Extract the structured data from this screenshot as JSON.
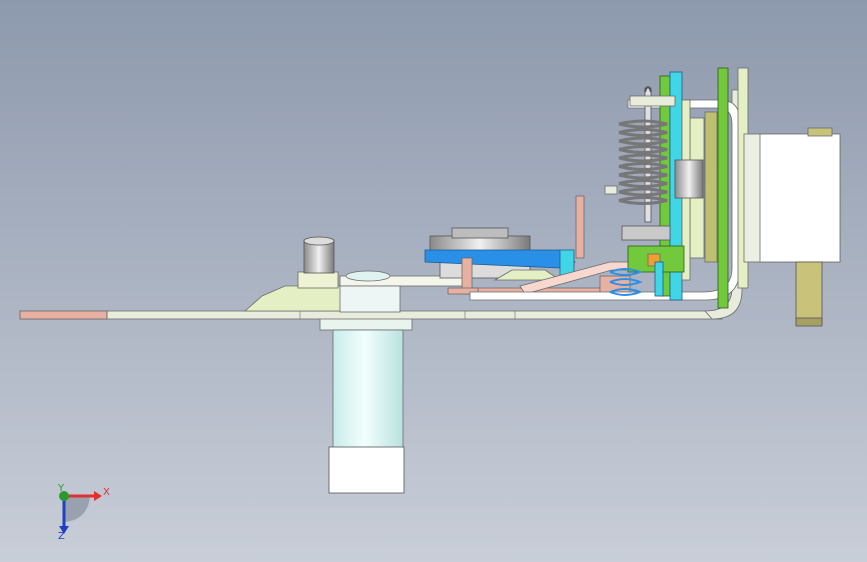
{
  "viewport": {
    "background_top": "#8d99ad",
    "background_bottom": "#c9ced8"
  },
  "colors": {
    "plate": "#e8ecdc",
    "plate_edge": "#6b6b6b",
    "salmon": "#e7b0a2",
    "cyan": "#40d6e6",
    "blue": "#2a8fe6",
    "green": "#73c93c",
    "olive": "#bcc070",
    "khaki": "#c9c27a",
    "light_green": "#e4efc4",
    "pale_cyan": "#d9f6f4",
    "metal": "#c9c9c9",
    "white": "#ffffff",
    "spring": "#d0d0d0",
    "orange": "#f0a030"
  },
  "triad": {
    "x_label": "X",
    "y_label": "Y",
    "z_label": "Z",
    "x_color": "#e03030",
    "y_color": "#2a9a2a",
    "z_color": "#2040c0"
  }
}
